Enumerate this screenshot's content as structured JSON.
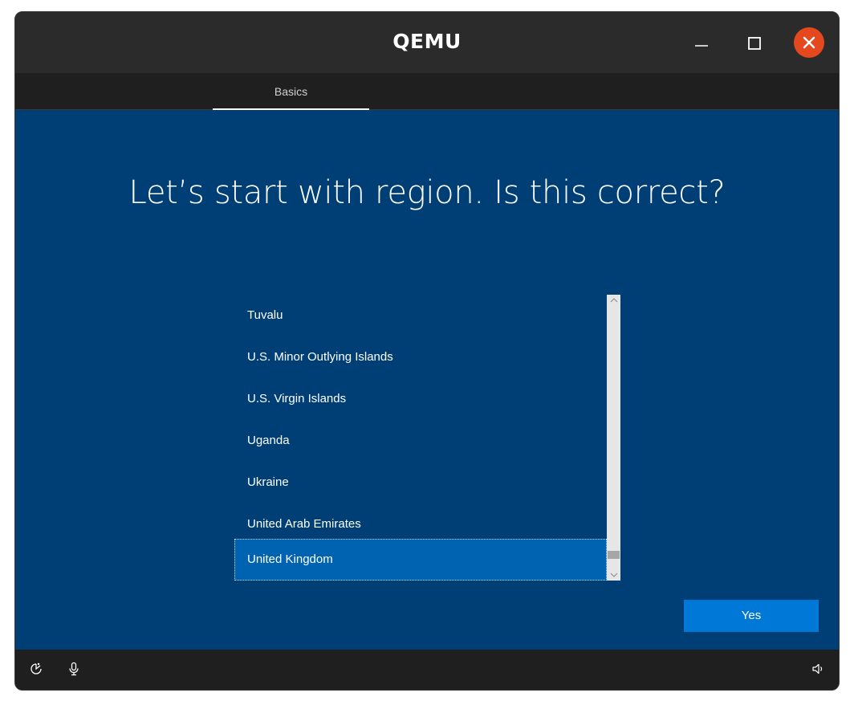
{
  "window": {
    "title": "QEMU"
  },
  "tabs": [
    {
      "label": "Basics"
    }
  ],
  "main": {
    "heading": "Let’s start with region. Is this correct?"
  },
  "region_list": {
    "items": [
      "Tuvalu",
      "U.S. Minor Outlying Islands",
      "U.S. Virgin Islands",
      "Uganda",
      "Ukraine",
      "United Arab Emirates",
      "United Kingdom"
    ],
    "selected": "United Kingdom",
    "scroll_position": 0.96
  },
  "actions": {
    "yes_label": "Yes"
  },
  "icons": {
    "minimize": "minimize-icon",
    "maximize": "maximize-icon",
    "close": "close-icon",
    "ease_of_access": "ease-of-access-icon",
    "microphone": "microphone-icon",
    "volume": "volume-icon"
  },
  "colors": {
    "content_background": "#003f75",
    "selected_item": "#0063b1",
    "primary_button": "#0078d7",
    "close_button": "#e5481e"
  }
}
